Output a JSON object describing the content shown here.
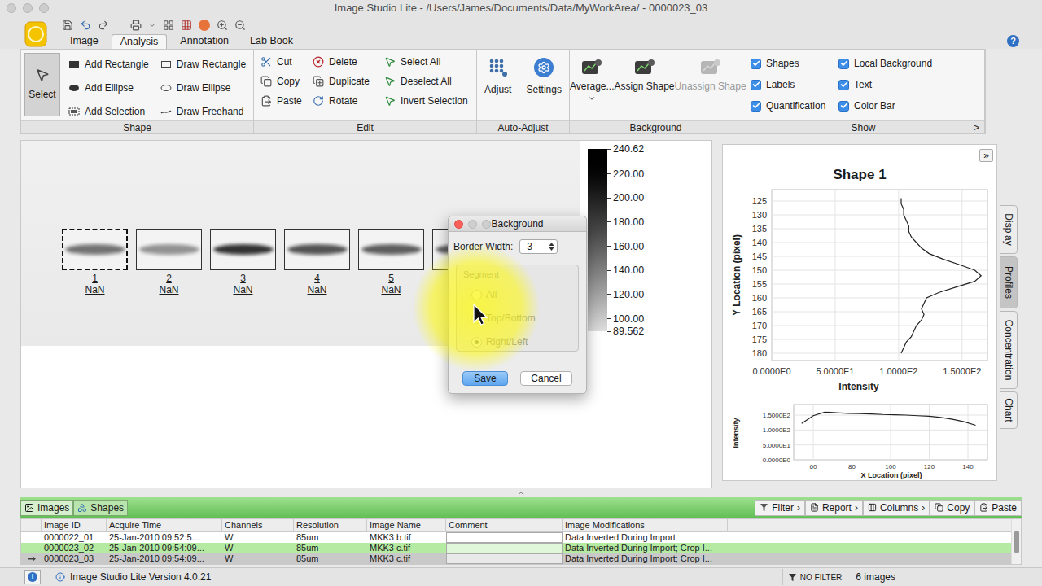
{
  "window": {
    "title": "Image Studio Lite - /Users/James/Documents/Data/MyWorkArea/ - 0000023_03"
  },
  "tabs": [
    {
      "label": "Image",
      "selected": false
    },
    {
      "label": "Analysis",
      "selected": true
    },
    {
      "label": "Annotation",
      "selected": false
    },
    {
      "label": "Lab Book",
      "selected": false
    }
  ],
  "help": "?",
  "ribbon": {
    "shape": {
      "title": "Shape",
      "select": {
        "label": "Select",
        "selected": true
      },
      "items": [
        "Add Rectangle",
        "Add Ellipse",
        "Add Selection",
        "Draw Rectangle",
        "Draw Ellipse",
        "Draw Freehand"
      ]
    },
    "edit": {
      "title": "Edit",
      "items": [
        "Cut",
        "Copy",
        "Paste",
        "Delete",
        "Duplicate",
        "Rotate",
        "Select All",
        "Deselect All",
        "Invert Selection"
      ]
    },
    "auto_adjust": {
      "title": "Auto-Adjust",
      "items": [
        "Adjust",
        "Settings"
      ]
    },
    "background": {
      "title": "Background",
      "items": [
        {
          "label": "Average...",
          "disabled": false,
          "has_menu": true
        },
        {
          "label": "Assign Shape",
          "disabled": false,
          "has_menu": false
        },
        {
          "label": "Unassign Shape",
          "disabled": true,
          "has_menu": false
        }
      ]
    },
    "show": {
      "title": "Show",
      "more": ">",
      "options": [
        {
          "label": "Shapes",
          "checked": true
        },
        {
          "label": "Labels",
          "checked": true
        },
        {
          "label": "Quantification",
          "checked": true
        },
        {
          "label": "Local Background",
          "checked": true
        },
        {
          "label": "Text",
          "checked": true
        },
        {
          "label": "Color Bar",
          "checked": true
        }
      ]
    }
  },
  "image": {
    "lanes": [
      {
        "number": "1",
        "value": "NaN",
        "selected": true,
        "darkness": 0.6
      },
      {
        "number": "2",
        "value": "NaN",
        "selected": false,
        "darkness": 0.45
      },
      {
        "number": "3",
        "value": "NaN",
        "selected": false,
        "darkness": 0.9
      },
      {
        "number": "4",
        "value": "NaN",
        "selected": false,
        "darkness": 0.75
      },
      {
        "number": "5",
        "value": "NaN",
        "selected": false,
        "darkness": 0.7
      }
    ],
    "covered_lane": {
      "darkness": 0.7
    },
    "color_bar": {
      "ticks": [
        "240.62",
        "220.00",
        "200.00",
        "180.00",
        "160.00",
        "140.00",
        "120.00",
        "100.00",
        "89.562"
      ]
    }
  },
  "dialog": {
    "title": "Background",
    "border_width_label": "Border Width:",
    "border_width": "3",
    "segment": {
      "label": "Segment",
      "disabled": true,
      "options": [
        {
          "label": "All",
          "selected": false
        },
        {
          "label": "Top/Bottom",
          "selected": false
        },
        {
          "label": "Right/Left",
          "selected": true
        }
      ]
    },
    "buttons": [
      {
        "label": "Save",
        "default": true
      },
      {
        "label": "Cancel",
        "default": false
      }
    ]
  },
  "side_panel": {
    "expand": "»",
    "title": "Shape 1",
    "tabs": [
      {
        "label": "Display",
        "selected": false
      },
      {
        "label": "Profiles",
        "selected": true
      },
      {
        "label": "Concentration",
        "selected": false
      },
      {
        "label": "Chart",
        "selected": false
      }
    ],
    "y_profile": {
      "y_axis_title": "Y Location (pixel)",
      "x_axis_title": "Intensity",
      "y_ticks": [
        "125",
        "130",
        "135",
        "140",
        "145",
        "150",
        "155",
        "160",
        "165",
        "170",
        "175",
        "180"
      ],
      "x_ticks": [
        "0.0000E0",
        "5.0000E1",
        "1.0000E2",
        "1.5000E2"
      ],
      "y_locations": [
        124,
        126,
        128,
        130,
        132,
        134,
        136,
        138,
        140,
        142,
        144,
        146,
        148,
        150,
        152,
        154,
        156,
        158,
        160,
        162,
        164,
        166,
        168,
        170,
        172,
        174,
        176,
        178,
        180
      ],
      "intensity": [
        102,
        102,
        104,
        104,
        106,
        108,
        108,
        110,
        114,
        118,
        124,
        135,
        148,
        160,
        165,
        160,
        146,
        132,
        122,
        120,
        118,
        120,
        118,
        114,
        112,
        110,
        106,
        104,
        102
      ]
    },
    "x_profile": {
      "x_axis_title": "X Location (pixel)",
      "y_axis_title": "Intensity",
      "x_ticks": [
        "60",
        "80",
        "100",
        "120",
        "140"
      ],
      "y_ticks": [
        "0.0000E0",
        "5.0000E1",
        "1.0000E2",
        "1.5000E2"
      ],
      "x_locations": [
        54,
        60,
        66,
        72,
        78,
        84,
        90,
        96,
        102,
        108,
        114,
        120,
        126,
        132,
        138,
        144
      ],
      "intensity": [
        122,
        148,
        160,
        158,
        156,
        155,
        154,
        152,
        151,
        150,
        148,
        146,
        142,
        136,
        128,
        116
      ]
    }
  },
  "bottom_tabs": [
    {
      "label": "Images",
      "selected": true
    },
    {
      "label": "Shapes",
      "selected": false
    }
  ],
  "bottom_actions": [
    {
      "label": "Filter",
      "arrow": "›"
    },
    {
      "label": "Report",
      "arrow": "›"
    },
    {
      "label": "Columns",
      "arrow": "›"
    },
    {
      "label": "Copy",
      "arrow": ""
    },
    {
      "label": "Paste",
      "arrow": ""
    }
  ],
  "table": {
    "columns": [
      "Image ID",
      "Acquire Time",
      "Channels",
      "Resolution",
      "Image Name",
      "Comment",
      "Image Modifications"
    ],
    "rows": [
      {
        "cells": [
          "0000022_01",
          "25-Jan-2010 09:52:5...",
          "W",
          "85um",
          "MKK3 b.tif",
          "",
          "Data Inverted During Import"
        ],
        "selected": false,
        "highlighted": false
      },
      {
        "cells": [
          "0000023_02",
          "25-Jan-2010 09:54:09...",
          "W",
          "85um",
          "MKK3 c.tif",
          "",
          "Data Inverted During Import; Crop I..."
        ],
        "selected": false,
        "highlighted": true
      },
      {
        "cells": [
          "0000023_03",
          "25-Jan-2010 09:54:09...",
          "W",
          "85um",
          "MKK3 c.tif",
          "",
          "Data Inverted During Import; Crop I..."
        ],
        "selected": true,
        "highlighted": false
      }
    ]
  },
  "status_bar": {
    "info": "i",
    "version": "Image Studio Lite Version 4.0.21",
    "filter": "NO FILTER",
    "count": "6 images"
  }
}
